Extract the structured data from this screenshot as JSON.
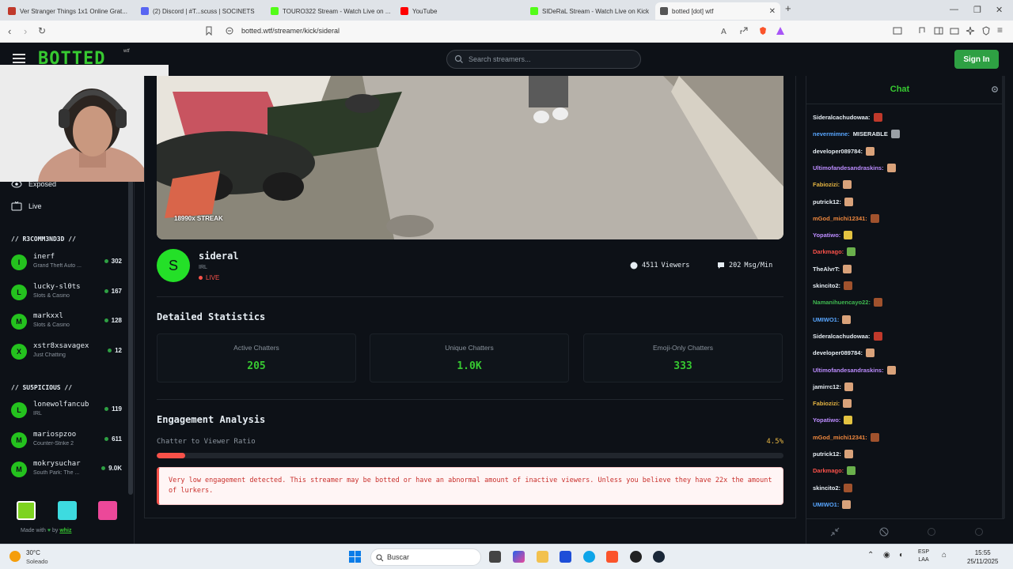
{
  "browser": {
    "tabs": [
      {
        "label": "Ver Stranger Things 1x1 Online Grat...",
        "color": "#c0392b"
      },
      {
        "label": "(2) Discord | #T...scuss | SOCINETS",
        "color": "#5865f2"
      },
      {
        "label": "TOURO322 Stream - Watch Live on ...",
        "color": "#53fc18"
      },
      {
        "label": "YouTube",
        "color": "#ff0000"
      },
      {
        "label": "SIDeRaL Stream - Watch Live on Kick",
        "color": "#53fc18"
      },
      {
        "label": "botted [dot] wtf",
        "color": "#555555"
      }
    ],
    "new_tab": "+",
    "url": "botted.wtf/streamer/kick/sideral"
  },
  "header": {
    "logo": "BOTTED",
    "logo_sup": "wtf",
    "search_placeholder": "Search streamers...",
    "signin_label": "Sign In"
  },
  "sidebar": {
    "nav": [
      {
        "label": "Exposed",
        "icon": "eye-icon"
      },
      {
        "label": "Live",
        "icon": "tv-icon"
      }
    ],
    "recommended_title": "// R3COMM3ND3D //",
    "recommended": [
      {
        "initial": "I",
        "name": "inerf",
        "game": "Grand Theft Auto ...",
        "count": "302"
      },
      {
        "initial": "L",
        "name": "lucky-sl0ts",
        "game": "Slots & Casino",
        "count": "167"
      },
      {
        "initial": "M",
        "name": "markxxl",
        "game": "Slots & Casino",
        "count": "128"
      },
      {
        "initial": "X",
        "name": "xstr8xsavagex",
        "game": "Just Chatting",
        "count": "12"
      }
    ],
    "suspicious_title": "// SU5PICIOUS //",
    "suspicious": [
      {
        "initial": "L",
        "name": "lonewolfancub",
        "game": "IRL",
        "count": "119"
      },
      {
        "initial": "M",
        "name": "mariospzoo",
        "game": "Counter-Strike 2",
        "count": "611"
      },
      {
        "initial": "M",
        "name": "mokrysuchar",
        "game": "South Park: The ...",
        "count": "9.0K"
      }
    ],
    "theme_colors": [
      "#7ed321",
      "#3ddbe0",
      "#ec4899"
    ],
    "made_with_prefix": "Made with",
    "made_with_by": "by",
    "made_with_author": "whiz"
  },
  "stream": {
    "streak_label": "18990x STREAK",
    "avatar_initial": "S",
    "name": "sideral",
    "category": "IRL",
    "live_label": "LIVE",
    "viewers_value": "4511",
    "viewers_label": "Viewers",
    "msgs_value": "202",
    "msgs_label": "Msg/Min"
  },
  "stats": {
    "title": "Detailed Statistics",
    "items": [
      {
        "label": "Active Chatters",
        "value": "205"
      },
      {
        "label": "Unique Chatters",
        "value": "1.0K"
      },
      {
        "label": "Emoji-Only Chatters",
        "value": "333"
      }
    ]
  },
  "engagement": {
    "title": "Engagement Analysis",
    "ratio_label": "Chatter to Viewer Ratio",
    "ratio_value": "4.5%",
    "ratio_fraction": 0.045,
    "warning": "Very low engagement detected. This streamer may be botted or have an abnormal amount of inactive viewers. Unless you believe they have 22x the amount of lurkers."
  },
  "chat": {
    "title": "Chat",
    "messages": [
      {
        "user": "Sideralcachudowaa:",
        "color": "#e6edf3",
        "text": "",
        "emote": "#c0392b"
      },
      {
        "user": "nevermimne:",
        "color": "#58a6ff",
        "text": "MISERABLE",
        "emote": "#9aa0a6"
      },
      {
        "user": "developer089784:",
        "color": "#e6edf3",
        "text": "",
        "emote": "#d9a27a"
      },
      {
        "user": "Ultimofandesandraskins:",
        "color": "#bc8cff",
        "text": "",
        "emote": "#d9a27a"
      },
      {
        "user": "Fabiozizi:",
        "color": "#e3b341",
        "text": "",
        "emote": "#d9a27a"
      },
      {
        "user": "putrick12:",
        "color": "#e6edf3",
        "text": "",
        "emote": "#d9a27a"
      },
      {
        "user": "mGod_michi12341:",
        "color": "#f0883e",
        "text": "",
        "emote": "#a0522d"
      },
      {
        "user": "Yopatiwo:",
        "color": "#bc8cff",
        "text": "",
        "emote": "#e3c341"
      },
      {
        "user": "Darkmago:",
        "color": "#f85149",
        "text": "",
        "emote": "#6ab04c"
      },
      {
        "user": "TheAlvrT:",
        "color": "#e6edf3",
        "text": "",
        "emote": "#d9a27a"
      },
      {
        "user": "skincito2:",
        "color": "#e6edf3",
        "text": "",
        "emote": "#a0522d"
      },
      {
        "user": "Namanihuencayo22:",
        "color": "#3fb950",
        "text": "",
        "emote": "#a0522d"
      },
      {
        "user": "UMIWO1:",
        "color": "#58a6ff",
        "text": "",
        "emote": "#d9a27a"
      },
      {
        "user": "Sideralcachudowaa:",
        "color": "#e6edf3",
        "text": "",
        "emote": "#c0392b"
      },
      {
        "user": "developer089784:",
        "color": "#e6edf3",
        "text": "",
        "emote": "#d9a27a"
      },
      {
        "user": "Ultimofandesandraskins:",
        "color": "#bc8cff",
        "text": "",
        "emote": "#d9a27a"
      },
      {
        "user": "jamirrc12:",
        "color": "#e6edf3",
        "text": "",
        "emote": "#d9a27a"
      },
      {
        "user": "Fabiozizi:",
        "color": "#e3b341",
        "text": "",
        "emote": "#d9a27a"
      },
      {
        "user": "Yopatiwo:",
        "color": "#bc8cff",
        "text": "",
        "emote": "#e3c341"
      },
      {
        "user": "mGod_michi12341:",
        "color": "#f0883e",
        "text": "",
        "emote": "#a0522d"
      },
      {
        "user": "putrick12:",
        "color": "#e6edf3",
        "text": "",
        "emote": "#d9a27a"
      },
      {
        "user": "Darkmago:",
        "color": "#f85149",
        "text": "",
        "emote": "#6ab04c"
      },
      {
        "user": "skincito2:",
        "color": "#e6edf3",
        "text": "",
        "emote": "#a0522d"
      },
      {
        "user": "UMIWO1:",
        "color": "#58a6ff",
        "text": "",
        "emote": "#d9a27a"
      }
    ]
  },
  "taskbar": {
    "temp": "30°C",
    "weather": "Soleado",
    "search": "Buscar",
    "lang_top": "ESP",
    "lang_bottom": "LAA",
    "time": "15:55",
    "date": "25/11/2025"
  }
}
